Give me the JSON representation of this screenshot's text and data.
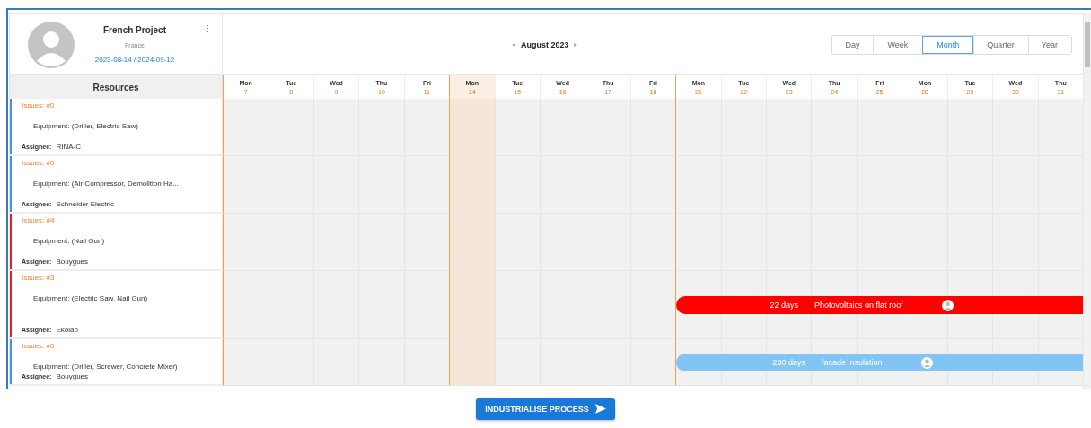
{
  "project": {
    "title": "French Project",
    "country": "France",
    "dates": "2023-08-14 / 2024-09-12",
    "menu_icon": "⋮"
  },
  "navigator": {
    "previous": "◂",
    "month": "August 2023",
    "next": "▸"
  },
  "views": [
    {
      "label": "Day",
      "selected": false
    },
    {
      "label": "Week",
      "selected": false
    },
    {
      "label": "Month",
      "selected": true
    },
    {
      "label": "Quarter",
      "selected": false
    },
    {
      "label": "Year",
      "selected": false
    }
  ],
  "resources_heading": "Resources",
  "days": [
    {
      "name": "Mon",
      "date": "7",
      "week_start": true,
      "today": false
    },
    {
      "name": "Tue",
      "date": "8",
      "week_start": false,
      "today": false
    },
    {
      "name": "Wed",
      "date": "9",
      "week_start": false,
      "today": false
    },
    {
      "name": "Thu",
      "date": "10",
      "week_start": false,
      "today": false
    },
    {
      "name": "Fri",
      "date": "11",
      "week_start": false,
      "today": false
    },
    {
      "name": "Mon",
      "date": "14",
      "week_start": true,
      "today": true
    },
    {
      "name": "Tue",
      "date": "15",
      "week_start": false,
      "today": false
    },
    {
      "name": "Wed",
      "date": "16",
      "week_start": false,
      "today": false
    },
    {
      "name": "Thu",
      "date": "17",
      "week_start": false,
      "today": false
    },
    {
      "name": "Fri",
      "date": "18",
      "week_start": false,
      "today": false
    },
    {
      "name": "Mon",
      "date": "21",
      "week_start": true,
      "today": false
    },
    {
      "name": "Tue",
      "date": "22",
      "week_start": false,
      "today": false
    },
    {
      "name": "Wed",
      "date": "23",
      "week_start": false,
      "today": false
    },
    {
      "name": "Thu",
      "date": "24",
      "week_start": false,
      "today": false
    },
    {
      "name": "Fri",
      "date": "25",
      "week_start": false,
      "today": false
    },
    {
      "name": "Mon",
      "date": "28",
      "week_start": true,
      "today": false
    },
    {
      "name": "Tue",
      "date": "29",
      "week_start": false,
      "today": false
    },
    {
      "name": "Wed",
      "date": "30",
      "week_start": false,
      "today": false
    },
    {
      "name": "Thu",
      "date": "31",
      "week_start": false,
      "today": false
    }
  ],
  "resources": [
    {
      "issues": "Issues: #0",
      "equipment": "Equipment: (Driller, Electric Saw)",
      "assignee_label": "Assignee:",
      "assignee": "RINA-C",
      "color": "#4a90d9"
    },
    {
      "issues": "Issues: #0",
      "equipment": "Equipment: (Air Compressor, Demolition Ha...",
      "assignee_label": "Assignee:",
      "assignee": "Schneider Electric",
      "color": "#4a90d9"
    },
    {
      "issues": "Issues: #4",
      "equipment": "Equipment: (Nail Gun)",
      "assignee_label": "Assignee:",
      "assignee": "Bouygues",
      "color": "#e8202a"
    },
    {
      "issues": "Issues: #3",
      "equipment": "Equipment: (Electric Saw, Nail Gun)",
      "assignee_label": "Assignee:",
      "assignee": "Ekolab",
      "color": "#e8202a",
      "task": {
        "duration": "22 days",
        "name": "Photovoltaics on flat roof",
        "color": "#ff0000"
      }
    },
    {
      "issues": "Issues: #0",
      "equipment": "Equipment: (Driller, Screwer, Concrete Mixer)",
      "assignee_label": "Assignee:",
      "assignee": "Bouygues",
      "color": "#4a90d9",
      "task": {
        "duration": "230 days",
        "name": "facade insulation",
        "color": "#82c4f5"
      }
    }
  ],
  "action_button": "INDUSTRIALISE PROCESS"
}
